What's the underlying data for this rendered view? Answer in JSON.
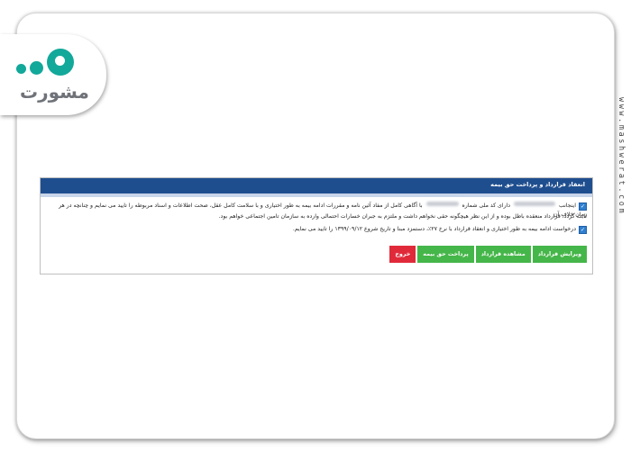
{
  "brand": {
    "logo_text": "مشورت",
    "side_url": "www.mashwerat.com",
    "accent_color": "#12a89a"
  },
  "panel": {
    "title": "انعقاد قرارداد و پرداخت حق بیمه",
    "header_color": "#1f4e8f",
    "line1_start": "اینجانب",
    "line1_mid": "دارای کد ملی شماره",
    "line1_end": "با آگاهی کامل از مفاد آئین نامه و مقررات ادامه بیمه به طور اختیاری و با سلامت کامل عقل، صحت اطلاعات و اسناد مربوطه را تایید می نمایم و چنانچه در هر زمان خلاف آن",
    "line2": "ثابت گردد، قرارداد منعقده باطل بوده و از این نظر هیچگونه حقی نخواهم داشت و ملتزم به جبران خسارات احتمالی وارده به سازمان تامین اجتماعی خواهم بود.",
    "line3": "درخواست ادامه بیمه به طور اختیاری و انعقاد قرارداد با نرخ ۲۷٪، دستمزد مبنا و تاریخ شروع ۱۳۹۹/۰۹/۱۲ را تایید می نمایم."
  },
  "buttons": {
    "edit": "ویرایش قرارداد",
    "view": "مشاهده قرارداد",
    "pay": "پرداخت حق بیمه",
    "exit": "خروج",
    "green_color": "#45b649",
    "red_color": "#e02a3a"
  }
}
